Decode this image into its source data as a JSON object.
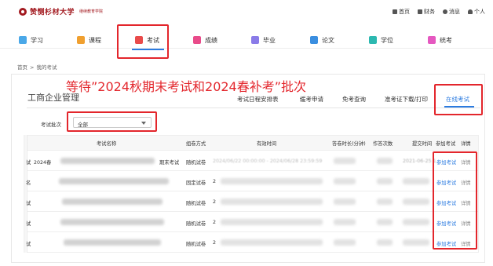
{
  "header": {
    "school_name": "赞恻杉材大学",
    "school_sub": "继续教育学院",
    "links": [
      {
        "label": "首页",
        "icon": "home-icon"
      },
      {
        "label": "财务",
        "icon": "wallet-icon"
      },
      {
        "label": "消息",
        "icon": "bell-icon"
      },
      {
        "label": "个人",
        "icon": "user-icon"
      }
    ]
  },
  "nav": {
    "items": [
      {
        "label": "学习",
        "icon": "study-icon",
        "color": "#4aa8e8"
      },
      {
        "label": "课程",
        "icon": "course-icon",
        "color": "#f0a030"
      },
      {
        "label": "考试",
        "icon": "exam-icon",
        "color": "#e94b4b"
      },
      {
        "label": "成绩",
        "icon": "grade-icon",
        "color": "#e94b8a"
      },
      {
        "label": "毕业",
        "icon": "graduate-icon",
        "color": "#8a7be8"
      },
      {
        "label": "论文",
        "icon": "paper-icon",
        "color": "#3a8ee0"
      },
      {
        "label": "学位",
        "icon": "degree-icon",
        "color": "#2cb8b0"
      },
      {
        "label": "统考",
        "icon": "unified-exam-icon",
        "color": "#e558c0"
      }
    ],
    "active_index": 2
  },
  "breadcrumb": {
    "home": "首页",
    "sep": ">",
    "current": "我的考试"
  },
  "annotation": "等待”2024秋期末考试和2024春补考”批次",
  "page_title": "工商企业管理",
  "tabs": [
    {
      "label": "考试日程安排表"
    },
    {
      "label": "缓考申请"
    },
    {
      "label": "免考查询"
    },
    {
      "label": "准考证下载/打印"
    },
    {
      "label": "在线考试"
    }
  ],
  "filter": {
    "label": "考试批次",
    "value": "全部"
  },
  "table": {
    "headers": [
      "考试名称",
      "组卷方式",
      "有效时间",
      "答卷时长(分钟)",
      "作答次数",
      "提交时间",
      "参加考试",
      "详情"
    ],
    "rows": [
      {
        "prefix": "试",
        "name_start": "2024春",
        "name_end": "期末考试",
        "method": "随机试卷",
        "time": "2024/06/22 00:00:00 - 2024/06/28 23:59:59",
        "submit": "2021-06-25 1",
        "action": "参加考试",
        "detail": "详情"
      },
      {
        "prefix": "名",
        "name_start": "",
        "name_end": "",
        "method": "固定试卷",
        "time": "2",
        "submit": "",
        "action": "参加考试",
        "detail": "详情"
      },
      {
        "prefix": "试",
        "name_start": "",
        "name_end": "",
        "method": "随机试卷",
        "time": "2",
        "submit": "",
        "action": "参加考试",
        "detail": "详情"
      },
      {
        "prefix": "试",
        "name_start": "",
        "name_end": "",
        "method": "随机试卷",
        "time": "2",
        "submit": "",
        "action": "参加考试",
        "detail": "详情"
      },
      {
        "prefix": "试",
        "name_start": "",
        "name_end": "",
        "method": "随机试卷",
        "time": "2",
        "submit": "",
        "action": "参加考试",
        "detail": "详情"
      }
    ]
  },
  "colors": {
    "accent": "#2b7be0",
    "highlight": "#e3262c",
    "brand": "#a2191f"
  }
}
